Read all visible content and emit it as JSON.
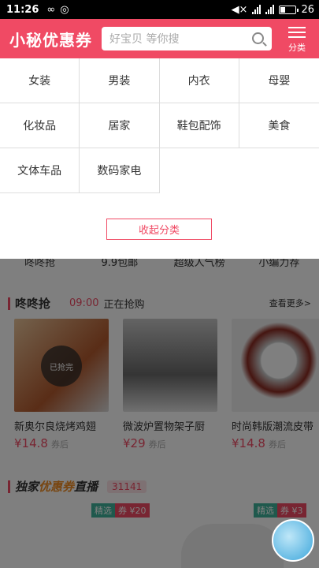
{
  "status": {
    "time": "11:26",
    "battery": "26"
  },
  "header": {
    "logo": "小秘优惠券",
    "search_placeholder": "好宝贝 等你搜",
    "category_label": "分类"
  },
  "categories": [
    "女装",
    "男装",
    "内衣",
    "母婴",
    "化妆品",
    "居家",
    "鞋包配饰",
    "美食",
    "文体车品",
    "数码家电"
  ],
  "collapse_label": "收起分类",
  "nav": [
    "咚咚抢",
    "9.9包邮",
    "超级人气榜",
    "小编力荐"
  ],
  "flash": {
    "title": "咚咚抢",
    "time": "09:00",
    "status": "正在抢购",
    "more": "查看更多>"
  },
  "products": [
    {
      "name": "新奥尔良烧烤鸡翅",
      "price": "¥14.8",
      "tag": "券后",
      "soldout": "已抢完"
    },
    {
      "name": "微波炉置物架子厨",
      "price": "¥29",
      "tag": "券后"
    },
    {
      "name": "时尚韩版潮流皮带",
      "price": "¥14.8",
      "tag": "券后"
    }
  ],
  "live": {
    "title_a": "独家",
    "title_b": "优惠券",
    "title_c": "直播",
    "count": "31141"
  },
  "badges": [
    {
      "pick": "精选",
      "coupon": "券 ¥20"
    },
    {
      "pick": "精选",
      "coupon": "券 ¥3"
    }
  ]
}
